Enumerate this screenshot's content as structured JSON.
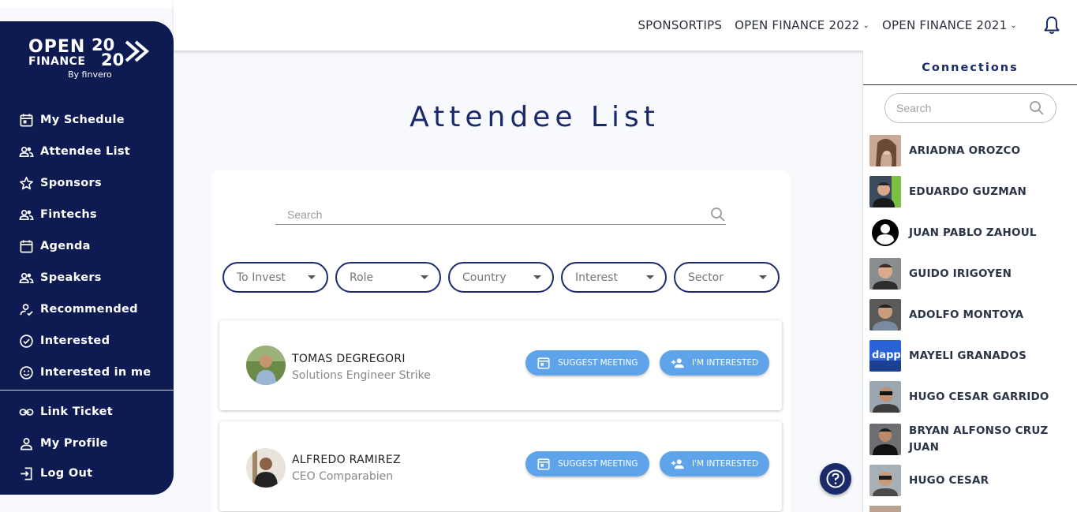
{
  "topnav": {
    "sponsortips": "SPONSORTIPS",
    "open_finance_2022": "OPEN FINANCE 2022",
    "open_finance_2021": "OPEN FINANCE 2021"
  },
  "logo": {
    "line1": "OPEN",
    "line2": "FINANCE",
    "by": "By finvero",
    "year": "20 20"
  },
  "sidebar": {
    "items": [
      {
        "label": "My Schedule",
        "icon": "calendar-icon"
      },
      {
        "label": "Attendee List",
        "icon": "people-icon"
      },
      {
        "label": "Sponsors",
        "icon": "star-icon"
      },
      {
        "label": "Fintechs",
        "icon": "people-icon"
      },
      {
        "label": "Agenda",
        "icon": "calendar-icon"
      },
      {
        "label": "Speakers",
        "icon": "people-icon"
      },
      {
        "label": "Recommended",
        "icon": "person-check-icon"
      },
      {
        "label": "Interested",
        "icon": "check-circle-icon"
      },
      {
        "label": "Interested in me",
        "icon": "smile-icon"
      }
    ],
    "bottom": [
      {
        "label": "Link Ticket",
        "icon": "link-icon"
      },
      {
        "label": "My Profile",
        "icon": "person-icon"
      },
      {
        "label": "Log Out",
        "icon": "logout-icon"
      }
    ]
  },
  "main": {
    "title": "Attendee List",
    "search_placeholder": "Search",
    "filters": [
      "To Invest",
      "Role",
      "Country",
      "Interest",
      "Sector"
    ],
    "attendees": [
      {
        "name": "TOMAS DEGREGORI",
        "role": "Solutions Engineer Strike"
      },
      {
        "name": "ALFREDO RAMIREZ",
        "role": "CEO Comparabien"
      }
    ],
    "suggest_label": "SUGGEST MEETING",
    "interested_label": "I'M INTERESTED"
  },
  "connections": {
    "title": "Connections",
    "search_placeholder": "Search",
    "people": [
      "ARIADNA OROZCO",
      "EDUARDO GUZMAN",
      "JUAN PABLO ZAHOUL",
      "GUIDO IRIGOYEN",
      "ADOLFO MONTOYA",
      "MAYELI GRANADOS",
      "HUGO CESAR GARRIDO",
      "BRYAN ALFONSO CRUZ JUAN",
      "HUGO CESAR"
    ]
  },
  "colors": {
    "navy": "#0d1b52",
    "accent": "#5fa4ea",
    "title": "#1b2a6b"
  }
}
